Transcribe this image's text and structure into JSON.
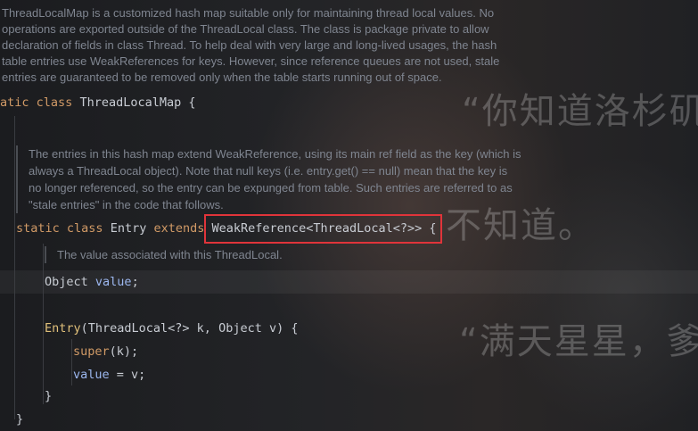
{
  "doc_comment_top": [
    "ThreadLocalMap is a customized hash map suitable only for maintaining thread local values. No",
    "operations are exported outside of the ThreadLocal class. The class is package private to allow",
    "declaration of fields in class Thread. To help deal with very large and long-lived usages, the hash",
    "table entries use WeakReferences for keys. However, since reference queues are not used, stale",
    "entries are guaranteed to be removed only when the table starts running out of space."
  ],
  "class_decl": {
    "kw1": "atic",
    "kw2": "class",
    "name": "ThreadLocalMap",
    "brace": "{"
  },
  "doc_comment_entry": [
    "The entries in this hash map extend WeakReference, using its main ref field as the key (which is",
    "always a ThreadLocal object). Note that null keys (i.e. entry.get() == null) mean that the key is",
    "no longer referenced, so the entry can be expunged from table. Such entries are referred to as",
    "\"stale entries\" in the code that follows."
  ],
  "entry_decl": {
    "kw1": "static",
    "kw2": "class",
    "name": "Entry",
    "extends": "extends",
    "super_type": "WeakReference<ThreadLocal<?>>",
    "brace": "{"
  },
  "doc_comment_value": "The value associated with this ThreadLocal.",
  "field_decl": {
    "type": "Object",
    "name": "value",
    "semi": ";"
  },
  "ctor": {
    "name": "Entry",
    "params": "(ThreadLocal<?> k, Object v) {",
    "super_call": "super",
    "super_args": "(k);",
    "assign_field": "value",
    "assign_rest": " = v;",
    "close_inner": "}",
    "close_outer": "}"
  },
  "wallpaper_text": [
    "“你知道洛杉矶",
    "不知道。",
    "“满天星星，爹"
  ],
  "colors": {
    "keyword": "#d19a66",
    "field": "#9cb7ef",
    "method": "#e0c07a",
    "highlight_box": "#e0343a"
  }
}
